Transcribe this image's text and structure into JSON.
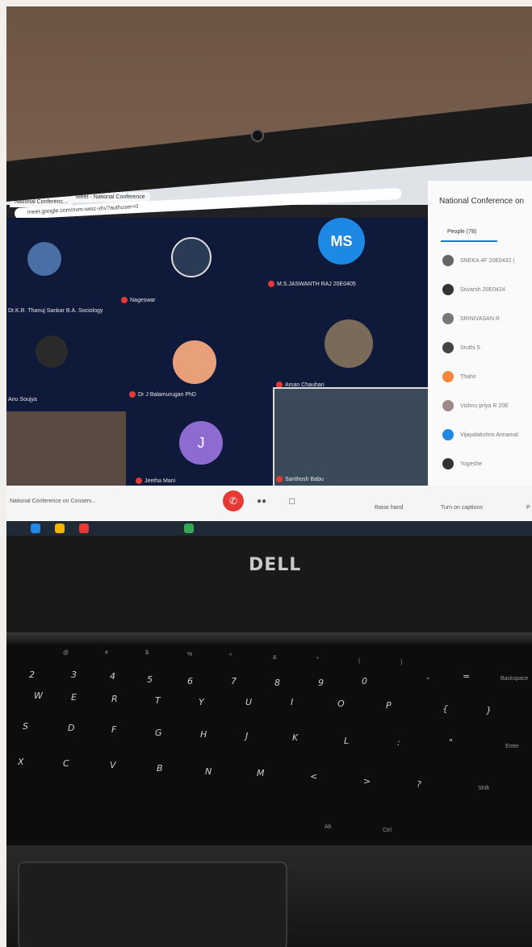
{
  "browser": {
    "tabs": [
      "National Conferenc...",
      "Meet - National Conference"
    ],
    "url": "meet.google.com/nvm-weiz-xhv?authuser=0"
  },
  "participants": [
    {
      "name": "Dr.K.R. Thanuj Sankar B.A. Sociology",
      "color": "#4a6fa5"
    },
    {
      "name": "Nageswar",
      "color": "#7a8aa0"
    },
    {
      "name": "M.S.JASWANTH RAJ 20E0405",
      "color": "#1e88e5",
      "initials": "MS"
    },
    {
      "name": "Dr J Balamurugan PhD",
      "color": "#e8a07a"
    },
    {
      "name": "Aman Chauhan",
      "color": "#7a6a5a"
    },
    {
      "name": "Anu Soujya",
      "color": "#3d3d3d"
    },
    {
      "name": "Jeetha Mani",
      "color": "#8e6bd1",
      "initials": "J"
    },
    {
      "name": "Santhosh Babu",
      "color": "#2e7d32"
    }
  ],
  "panel": {
    "title": "National Conference on",
    "tab": "People (78)",
    "people": [
      {
        "name": "SNEKA 4F 20E0432 (",
        "color": "#666"
      },
      {
        "name": "Srivarsh 20E0424",
        "color": "#333"
      },
      {
        "name": "SRINIVASAN R",
        "color": "#777"
      },
      {
        "name": "Sruthi S",
        "color": "#444"
      },
      {
        "name": "Thahir",
        "color": "#f4863b"
      },
      {
        "name": "Vishnu priya R 20E",
        "color": "#9e8a8a"
      },
      {
        "name": "Vijayalakshmi Annamal",
        "color": "#1e88e5"
      },
      {
        "name": "Yogeshe",
        "color": "#333"
      }
    ]
  },
  "controls": {
    "meeting_name": "National Conference on Conserv...",
    "raise_hand": "Raise hand",
    "turn_on_captions": "Turn on captions",
    "present_now": "P"
  },
  "laptop": {
    "brand": "DELL"
  },
  "keyboard": {
    "row1": [
      "@",
      "#",
      "$",
      "%",
      "^",
      "&",
      "*",
      "(",
      ")",
      "_",
      "+"
    ],
    "row1_digits": [
      "2",
      "3",
      "4",
      "5",
      "6",
      "7",
      "8",
      "9",
      "0",
      "-",
      "="
    ],
    "row2": [
      "W",
      "E",
      "R",
      "T",
      "Y",
      "U",
      "I",
      "O",
      "P",
      "{",
      "}"
    ],
    "row3": [
      "S",
      "D",
      "F",
      "G",
      "H",
      "J",
      "K",
      "L",
      ":",
      "\""
    ],
    "row4": [
      "X",
      "C",
      "V",
      "B",
      "N",
      "M",
      "<",
      ">",
      "?"
    ],
    "backspace": "Backspace",
    "enter": "Enter",
    "shift": "Shift",
    "alt": "Alt",
    "ctrl": "Ctrl"
  }
}
